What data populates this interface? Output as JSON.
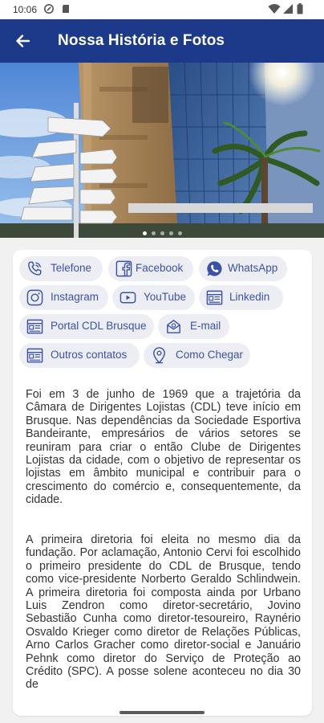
{
  "status_bar": {
    "time": "10:06"
  },
  "app_bar": {
    "title": "Nossa História e Fotos"
  },
  "carousel": {
    "total_slides": 5,
    "active_slide": 1
  },
  "contact_chips": [
    {
      "label": "Telefone",
      "icon": "phone-icon"
    },
    {
      "label": "Facebook",
      "icon": "facebook-icon"
    },
    {
      "label": "WhatsApp",
      "icon": "whatsapp-icon"
    },
    {
      "label": "Instagram",
      "icon": "instagram-icon"
    },
    {
      "label": "YouTube",
      "icon": "youtube-icon"
    },
    {
      "label": "Linkedin",
      "icon": "linkedin-icon"
    },
    {
      "label": "Portal CDL Brusque",
      "icon": "portal-icon"
    },
    {
      "label": "E-mail",
      "icon": "email-icon"
    },
    {
      "label": "Outros contatos",
      "icon": "contacts-icon"
    },
    {
      "label": "Como Chegar",
      "icon": "location-pin-icon"
    }
  ],
  "history": {
    "paragraph_1": "Foi em 3 de junho de 1969 que a trajetória da Câmara de Dirigentes Lojistas (CDL) teve início em Brusque. Nas dependências da Sociedade Esportiva Bandeirante, empresários de vários setores se reuniram para criar o então Clube de Dirigentes Lojistas da cidade, com o objetivo de representar os lojistas em âmbito municipal e contribuir para o crescimento do comércio e, consequentemente, da cidade.",
    "paragraph_2": "A primeira diretoria foi eleita no mesmo dia da fundação. Por aclamação, Antonio Cervi foi escolhido o primeiro presidente do CDL de Brusque, tendo como vice-presidente Norberto Geraldo Schlindwein. A primeira diretoria foi composta ainda por Urbano Luis Zendron como diretor-secretário, Jovino Sebastião Cunha como diretor-tesoureiro, Raynério Osvaldo Krieger como diretor de Relações Públicas, Arno Carlos Gracher como diretor-social e Januário Pehnk como diretor do Serviço de Proteção ao Crédito (SPC). A posse solene aconteceu no dia 30 de"
  },
  "colors": {
    "primary": "#1d3a8a",
    "chip_bg": "#edeef3",
    "chip_text": "#3a52a8"
  }
}
